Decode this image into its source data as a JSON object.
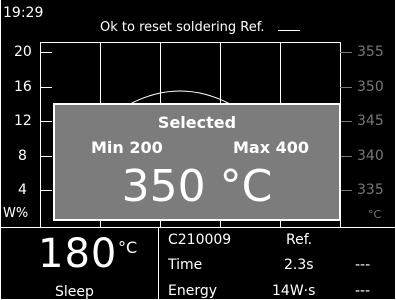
{
  "status_bar": {
    "time": "19:29",
    "message": "Ok to reset soldering Ref."
  },
  "graph": {
    "left_axis": {
      "ticks": [
        "20",
        "16",
        "12",
        "8",
        "4"
      ],
      "unit": "W%"
    },
    "right_axis": {
      "ticks": [
        "355",
        "350",
        "345",
        "340",
        "335"
      ],
      "unit": "°C"
    }
  },
  "popup": {
    "title": "Selected",
    "min_label": "Min 200",
    "max_label": "Max 400",
    "value": "350",
    "unit": "°C"
  },
  "iron": {
    "temperature": "180",
    "unit": "°C",
    "state": "Sleep"
  },
  "info": {
    "profile": "C210009",
    "ref_header": "Ref.",
    "rows": [
      {
        "label": "Time",
        "value": "2.3s",
        "ref": "---"
      },
      {
        "label": "Energy",
        "value": "14W·s",
        "ref": "---"
      }
    ]
  }
}
